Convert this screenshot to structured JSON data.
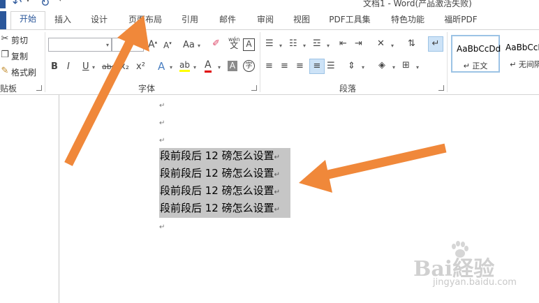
{
  "window": {
    "title": "文档1 - Word(产品激活失败)"
  },
  "tabs": [
    "开始",
    "插入",
    "设计",
    "页面布局",
    "引用",
    "邮件",
    "审阅",
    "视图",
    "PDF工具集",
    "特色功能",
    "福昕PDF"
  ],
  "active_tab": "开始",
  "clipboard": {
    "cut": "剪切",
    "copy": "复制",
    "format_painter": "格式刷",
    "group_label": "贴板"
  },
  "font": {
    "group_label": "字体",
    "font_name_value": "",
    "font_size_value": "",
    "case_label": "Aa",
    "bold": "B",
    "italic": "I",
    "underline": "U",
    "strike": "abc",
    "subscript": "x₂",
    "superscript": "x²",
    "phonetic_top": "wén",
    "phonetic_bottom": "文",
    "grow_font": "A",
    "shrink_font": "A",
    "effects": "A",
    "highlight": "ab",
    "font_color": "A",
    "char_shading": "A",
    "enclose": "字",
    "border_char": "A"
  },
  "paragraph": {
    "group_label": "段落"
  },
  "styles": [
    {
      "sample": "AaBbCcDd",
      "name": "↵ 正文"
    },
    {
      "sample": "AaBbCcDd",
      "name": "↵ 无间隔"
    }
  ],
  "document": {
    "empty_marks": [
      "↵",
      "↵",
      "↵"
    ],
    "lines": [
      "段前段后 12 磅怎么设置",
      "段前段后 12 磅怎么设置",
      "段前段后 12 磅怎么设置",
      "段前段后 12 磅怎么设置"
    ],
    "line_mark": "↵",
    "trailing_mark": "↵"
  },
  "watermark": {
    "logo": "Bai経验",
    "url": "jingyan.baidu.com"
  },
  "colors": {
    "accent": "#2b579a",
    "arrow": "#f0883a",
    "selection": "#c6c6c6",
    "font_color_bar": "#e00000"
  }
}
